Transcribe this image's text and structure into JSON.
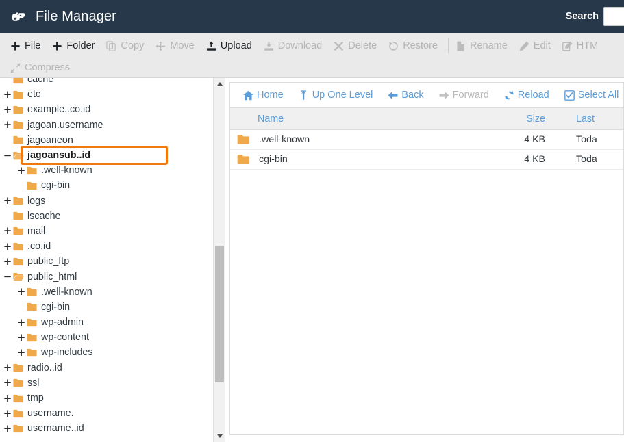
{
  "header": {
    "logo_icon": "cpanel-logo-icon",
    "title": "File Manager",
    "search_label": "Search",
    "search_placeholder": ""
  },
  "toolbar": {
    "row1": [
      {
        "label": "File",
        "icon": "plus-icon",
        "disabled": false,
        "sep_after": false
      },
      {
        "label": "Folder",
        "icon": "plus-icon",
        "disabled": false,
        "sep_after": false
      },
      {
        "label": "Copy",
        "icon": "copy-icon",
        "disabled": true,
        "sep_after": false
      },
      {
        "label": "Move",
        "icon": "move-icon",
        "disabled": true,
        "sep_after": false
      },
      {
        "label": "Upload",
        "icon": "upload-icon",
        "disabled": false,
        "sep_after": false
      },
      {
        "label": "Download",
        "icon": "download-icon",
        "disabled": true,
        "sep_after": false
      },
      {
        "label": "Delete",
        "icon": "delete-x-icon",
        "disabled": true,
        "sep_after": false
      },
      {
        "label": "Restore",
        "icon": "restore-icon",
        "disabled": true,
        "sep_after": true
      },
      {
        "label": "Rename",
        "icon": "file-icon",
        "disabled": true,
        "sep_after": false
      },
      {
        "label": "Edit",
        "icon": "pencil-icon",
        "disabled": true,
        "sep_after": false
      },
      {
        "label": "HTM",
        "icon": "html-editor-icon",
        "disabled": true,
        "sep_after": false
      }
    ],
    "row2": [
      {
        "label": "Compress",
        "icon": "compress-icon",
        "disabled": true
      }
    ]
  },
  "tree": {
    "items": [
      {
        "label": "cache",
        "toggle": "",
        "indent": 0,
        "selected": false,
        "clipped_top": true,
        "suffix": ""
      },
      {
        "label": "etc",
        "toggle": "+",
        "indent": 0,
        "selected": false,
        "suffix": ""
      },
      {
        "label": "example.",
        "toggle": "+",
        "indent": 0,
        "selected": false,
        "redacted": "              ",
        "suffix": ".co.id"
      },
      {
        "label": "jagoan.username",
        "toggle": "+",
        "indent": 0,
        "selected": false,
        "suffix": ""
      },
      {
        "label": "jagoaneon",
        "toggle": "",
        "indent": 0,
        "selected": false,
        "suffix": ""
      },
      {
        "label": "jagoansub.",
        "toggle": "−",
        "indent": 0,
        "selected": true,
        "redacted": "        ",
        "suffix": ".id"
      },
      {
        "label": ".well-known",
        "toggle": "+",
        "indent": 1,
        "selected": false,
        "suffix": ""
      },
      {
        "label": "cgi-bin",
        "toggle": "",
        "indent": 1,
        "selected": false,
        "suffix": ""
      },
      {
        "label": "logs",
        "toggle": "+",
        "indent": 0,
        "selected": false,
        "suffix": ""
      },
      {
        "label": "lscache",
        "toggle": "",
        "indent": 0,
        "selected": false,
        "suffix": ""
      },
      {
        "label": "mail",
        "toggle": "+",
        "indent": 0,
        "selected": false,
        "suffix": ""
      },
      {
        "label": "",
        "toggle": "+",
        "indent": 0,
        "selected": false,
        "redacted": "                  ",
        "suffix": ".co.id"
      },
      {
        "label": "public_ftp",
        "toggle": "+",
        "indent": 0,
        "selected": false,
        "suffix": ""
      },
      {
        "label": "public_html",
        "toggle": "−",
        "indent": 0,
        "selected": false,
        "suffix": ""
      },
      {
        "label": ".well-known",
        "toggle": "+",
        "indent": 1,
        "selected": false,
        "suffix": ""
      },
      {
        "label": "cgi-bin",
        "toggle": "",
        "indent": 1,
        "selected": false,
        "suffix": ""
      },
      {
        "label": "wp-admin",
        "toggle": "+",
        "indent": 1,
        "selected": false,
        "suffix": ""
      },
      {
        "label": "wp-content",
        "toggle": "+",
        "indent": 1,
        "selected": false,
        "suffix": ""
      },
      {
        "label": "wp-includes",
        "toggle": "+",
        "indent": 1,
        "selected": false,
        "suffix": ""
      },
      {
        "label": "radio.",
        "toggle": "+",
        "indent": 0,
        "selected": false,
        "redacted": "       ",
        "suffix": ".id"
      },
      {
        "label": "ssl",
        "toggle": "+",
        "indent": 0,
        "selected": false,
        "suffix": ""
      },
      {
        "label": "tmp",
        "toggle": "+",
        "indent": 0,
        "selected": false,
        "suffix": ""
      },
      {
        "label": "username.",
        "toggle": "+",
        "indent": 0,
        "selected": false,
        "suffix": ""
      },
      {
        "label": "username.",
        "toggle": "+",
        "indent": 0,
        "selected": false,
        "redacted": "        ",
        "suffix": ".id"
      }
    ],
    "scrollbar": {
      "up_icon": "scroll-up-arrow-icon",
      "down_icon": "scroll-down-arrow-icon"
    }
  },
  "filepanel": {
    "nav": [
      {
        "label": "Home",
        "icon": "home-icon",
        "disabled": false
      },
      {
        "label": "Up One Level",
        "icon": "up-arrow-icon",
        "disabled": false
      },
      {
        "label": "Back",
        "icon": "arrow-left-icon",
        "disabled": false
      },
      {
        "label": "Forward",
        "icon": "arrow-right-icon",
        "disabled": true
      },
      {
        "label": "Reload",
        "icon": "reload-icon",
        "disabled": false
      },
      {
        "label": "Select All",
        "icon": "checkbox-icon",
        "disabled": false
      }
    ],
    "columns": {
      "name": "Name",
      "size": "Size",
      "last": "Last"
    },
    "rows": [
      {
        "name": ".well-known",
        "size": "4 KB",
        "last": "Toda",
        "icon": "folder-icon"
      },
      {
        "name": "cgi-bin",
        "size": "4 KB",
        "last": "Toda",
        "icon": "folder-icon"
      }
    ]
  },
  "colors": {
    "header_bg": "#263849",
    "toolbar_bg": "#eaeaea",
    "folder_orange": "#efa94a",
    "selection_orange": "#ef7b10",
    "link_blue": "#5b9dd9",
    "disabled_gray": "#b5b5b5"
  }
}
